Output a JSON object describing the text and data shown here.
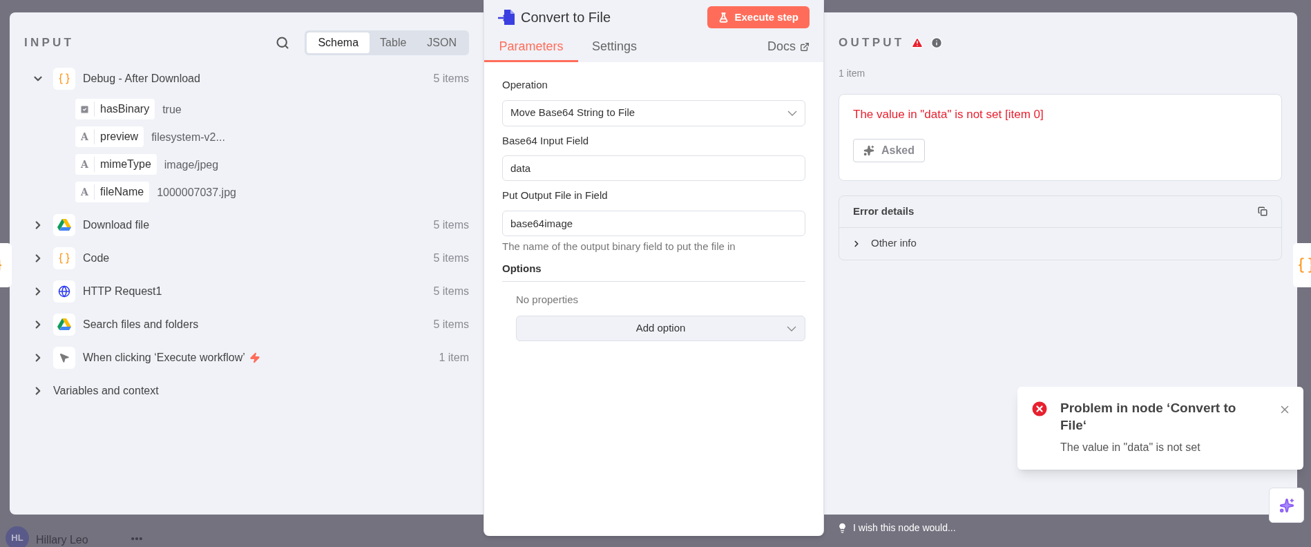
{
  "input": {
    "title": "INPUT",
    "view_tabs": [
      {
        "label": "Schema",
        "selected": true
      },
      {
        "label": "Table",
        "selected": false
      },
      {
        "label": "JSON",
        "selected": false
      }
    ],
    "nodes": [
      {
        "name": "Debug - After Download",
        "kind": "code",
        "count": "5 items",
        "expanded": true,
        "trigger": false,
        "children": [
          {
            "kind": "boolean",
            "key": "hasBinary",
            "value": "true"
          },
          {
            "kind": "string",
            "glyph": "A",
            "key": "preview",
            "value": "filesystem-v2..."
          },
          {
            "kind": "string",
            "glyph": "A",
            "key": "mimeType",
            "value": "image/jpeg"
          },
          {
            "kind": "string",
            "glyph": "A",
            "key": "fileName",
            "value": "1000007037.jpg"
          }
        ]
      },
      {
        "name": "Download file",
        "kind": "drive",
        "count": "5 items",
        "expanded": false,
        "trigger": false
      },
      {
        "name": "Code",
        "kind": "code",
        "count": "5 items",
        "expanded": false,
        "trigger": false
      },
      {
        "name": "HTTP Request1",
        "kind": "http",
        "count": "5 items",
        "expanded": false,
        "trigger": false
      },
      {
        "name": "Search files and folders",
        "kind": "drive",
        "count": "5 items",
        "expanded": false,
        "trigger": false
      },
      {
        "name": "When clicking ‘Execute workflow’",
        "kind": "manual",
        "count": "1 item",
        "expanded": false,
        "trigger": true
      }
    ],
    "context": {
      "label": "Variables and context",
      "expanded": false
    }
  },
  "node": {
    "title": "Convert to File",
    "execute_button": "Execute step",
    "tabs": [
      {
        "label": "Parameters",
        "selected": true
      },
      {
        "label": "Settings",
        "selected": false
      }
    ],
    "docs_link": "Docs",
    "fields": [
      {
        "kind": "select",
        "label": "Operation",
        "value": "Move Base64 String to File"
      },
      {
        "kind": "input",
        "label": "Base64 Input Field",
        "value": "data"
      },
      {
        "kind": "input",
        "label": "Put Output File in Field",
        "value": "base64image",
        "hint": "The name of the output binary field to put the file in"
      }
    ],
    "options": {
      "title": "Options",
      "empty_text": "No properties",
      "add_button": "Add option"
    }
  },
  "output": {
    "title": "OUTPUT",
    "count": "1 item",
    "error": {
      "message": "The value in \"data\" is not set [item 0]",
      "ask_button": "Asked"
    },
    "error_details": {
      "title": "Error details",
      "sections": [
        {
          "label": "Other info",
          "expanded": false
        }
      ]
    }
  },
  "toast": {
    "title": "Problem in node ‘Convert to File‘",
    "message": "The value in \"data\" is not set"
  },
  "feedback": {
    "text": "I wish this node would..."
  },
  "user": {
    "initials": "HL",
    "name": "Hillary Leo"
  }
}
